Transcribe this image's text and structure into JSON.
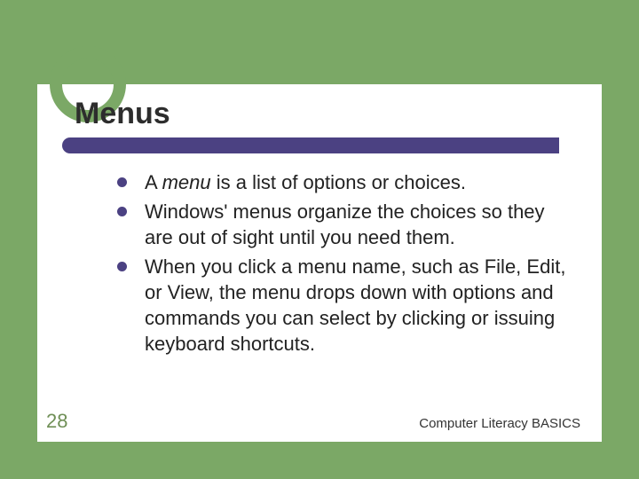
{
  "slide": {
    "title": "Menus",
    "bullets": [
      {
        "prefix": "A ",
        "em": "menu",
        "rest": " is a list of options or choices."
      },
      {
        "text": "Windows' menus organize the choices so they are out of sight until you need them."
      },
      {
        "text": "When you click a menu name, such as File, Edit, or View, the menu drops down with options and commands you can select by clicking or issuing keyboard shortcuts."
      }
    ],
    "page_number": "28",
    "footer": "Computer Literacy BASICS"
  }
}
